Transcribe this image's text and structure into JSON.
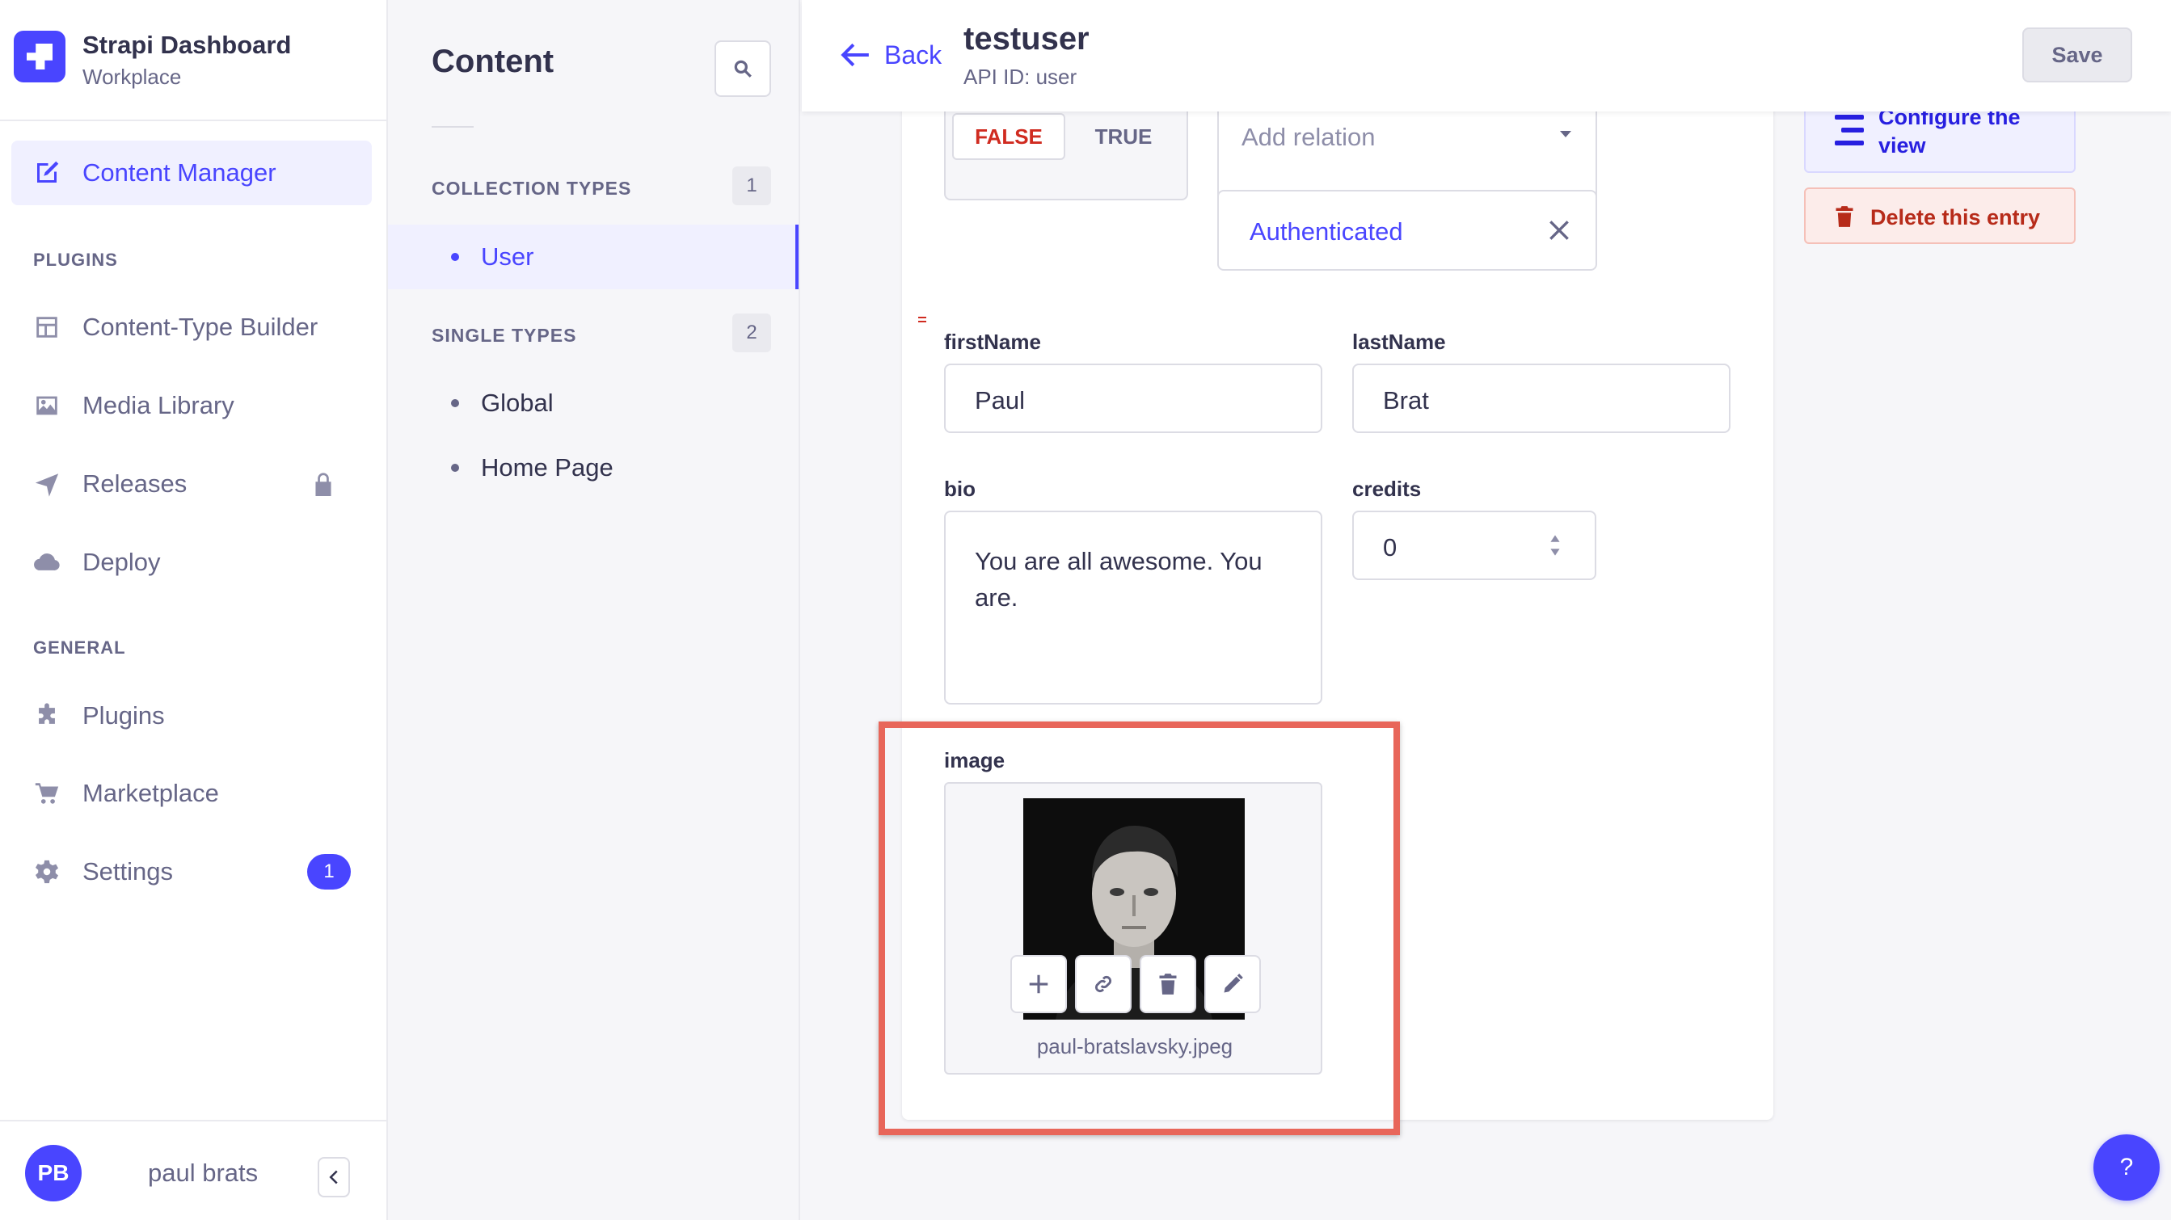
{
  "brand": {
    "title": "Strapi Dashboard",
    "subtitle": "Workplace"
  },
  "main_nav": {
    "content_manager": "Content Manager",
    "plugins_section": "PLUGINS",
    "content_type_builder": "Content-Type Builder",
    "media_library": "Media Library",
    "releases": "Releases",
    "deploy": "Deploy",
    "general_section": "GENERAL",
    "plugins": "Plugins",
    "marketplace": "Marketplace",
    "settings": "Settings",
    "settings_badge": "1"
  },
  "profile": {
    "initials": "PB",
    "name": "paul brats"
  },
  "sub_nav": {
    "title": "Content",
    "collection_types_label": "COLLECTION TYPES",
    "collection_types_count": "1",
    "collection_items": [
      "User"
    ],
    "single_types_label": "SINGLE TYPES",
    "single_types_count": "2",
    "single_items": [
      "Global",
      "Home Page"
    ]
  },
  "header": {
    "back_label": "Back",
    "title": "testuser",
    "api_id": "API ID: user",
    "save_label": "Save"
  },
  "form": {
    "toggle_false": "FALSE",
    "toggle_true": "TRUE",
    "relation_placeholder": "Add relation",
    "relation_chip": "Authenticated",
    "first_name_label": "firstName",
    "first_name_value": "Paul",
    "last_name_label": "lastName",
    "last_name_value": "Brat",
    "bio_label": "bio",
    "bio_value": "You are all awesome. You are.",
    "credits_label": "credits",
    "credits_value": "0",
    "image_label": "image",
    "image_filename": "paul-bratslavsky.jpeg"
  },
  "actions": {
    "configure_label": "Configure the view",
    "delete_label": "Delete this entry"
  },
  "help_label": "?",
  "colors": {
    "primary": "#4945ff",
    "danger": "#d02b20",
    "highlight": "#e8665a"
  }
}
